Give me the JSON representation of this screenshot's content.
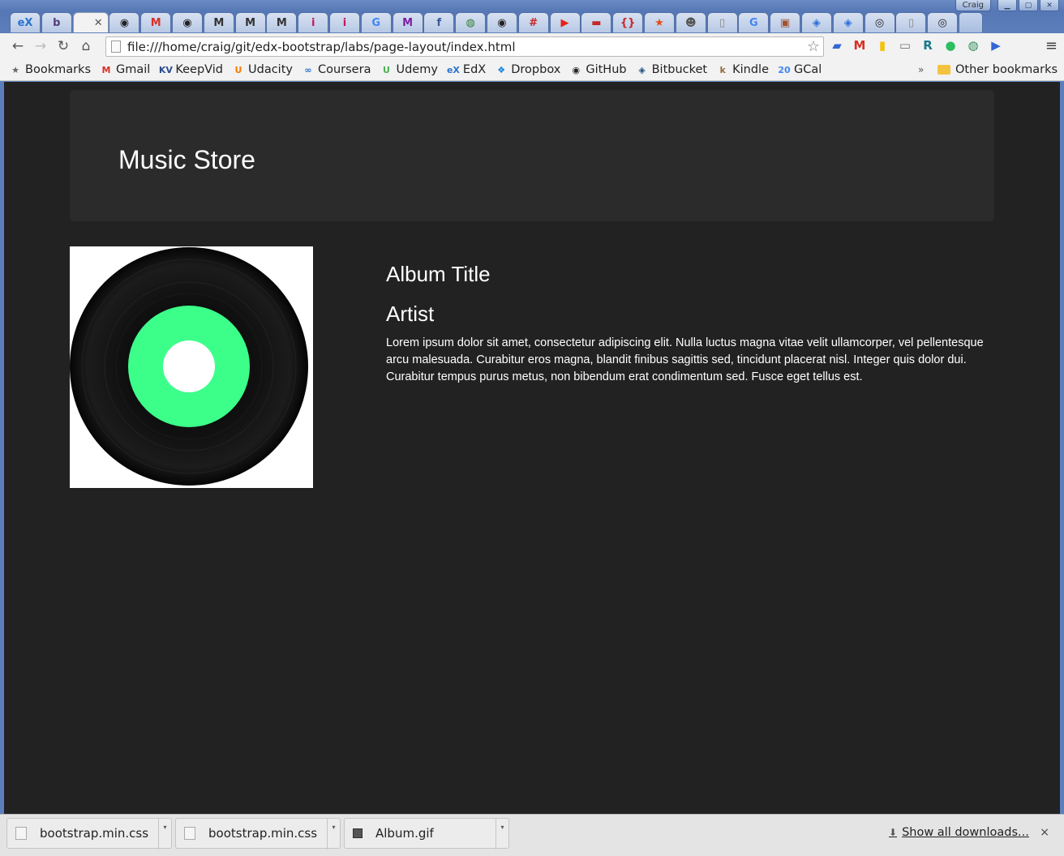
{
  "browser": {
    "profile_name": "Craig",
    "url": "file:///home/craig/git/edx-bootstrap/labs/page-layout/index.html",
    "tabs": [
      {
        "icon": "edx-icon",
        "glyph": "eX",
        "color": "#2a73cc"
      },
      {
        "icon": "bootstrap-icon",
        "glyph": "b",
        "color": "#563d7c"
      },
      {
        "icon": "close-icon",
        "glyph": "✕",
        "color": "#555"
      },
      {
        "icon": "github-icon",
        "glyph": "◉",
        "color": "#222"
      },
      {
        "icon": "gmail-icon",
        "glyph": "M",
        "color": "#d93025"
      },
      {
        "icon": "github-icon",
        "glyph": "◉",
        "color": "#222"
      },
      {
        "icon": "medium-icon",
        "glyph": "M",
        "color": "#333"
      },
      {
        "icon": "medium-icon",
        "glyph": "M",
        "color": "#333"
      },
      {
        "icon": "medium-icon",
        "glyph": "M",
        "color": "#333"
      },
      {
        "icon": "info-icon",
        "glyph": "i",
        "color": "#c2185b"
      },
      {
        "icon": "info-icon",
        "glyph": "i",
        "color": "#c2185b"
      },
      {
        "icon": "google-icon",
        "glyph": "G",
        "color": "#4285f4"
      },
      {
        "icon": "m-icon",
        "glyph": "M",
        "color": "#7b1fa2"
      },
      {
        "icon": "facebook-icon",
        "glyph": "f",
        "color": "#3b5998"
      },
      {
        "icon": "globe-icon",
        "glyph": "◍",
        "color": "#2e7d32"
      },
      {
        "icon": "github-icon",
        "glyph": "◉",
        "color": "#222"
      },
      {
        "icon": "slack-icon",
        "glyph": "#",
        "color": "#c62828"
      },
      {
        "icon": "youtube-icon",
        "glyph": "▶",
        "color": "#e62117"
      },
      {
        "icon": "red-tag-icon",
        "glyph": "▬",
        "color": "#c62828"
      },
      {
        "icon": "bracket-icon",
        "glyph": "{}",
        "color": "#c62828"
      },
      {
        "icon": "star-icon",
        "glyph": "★",
        "color": "#e64a19"
      },
      {
        "icon": "skull-icon",
        "glyph": "☻",
        "color": "#555"
      },
      {
        "icon": "page-icon",
        "glyph": "▯",
        "color": "#888"
      },
      {
        "icon": "google-icon",
        "glyph": "G",
        "color": "#4285f4"
      },
      {
        "icon": "image-icon",
        "glyph": "▣",
        "color": "#a0522d"
      },
      {
        "icon": "shield-icon",
        "glyph": "◈",
        "color": "#2a6fdb"
      },
      {
        "icon": "shield-icon",
        "glyph": "◈",
        "color": "#2a6fdb"
      },
      {
        "icon": "circle-icon",
        "glyph": "◎",
        "color": "#222"
      },
      {
        "icon": "page-icon",
        "glyph": "▯",
        "color": "#888"
      },
      {
        "icon": "circle-icon",
        "glyph": "◎",
        "color": "#222"
      }
    ],
    "extensions": [
      {
        "icon": "cast-tab-icon",
        "glyph": "▰",
        "color": "#3367d6"
      },
      {
        "icon": "gmail-icon",
        "glyph": "M",
        "color": "#d93025"
      },
      {
        "icon": "keep-icon",
        "glyph": "▮",
        "color": "#f4c20d"
      },
      {
        "icon": "cast-icon",
        "glyph": "▭",
        "color": "#777"
      },
      {
        "icon": "r-icon",
        "glyph": "R",
        "color": "#1a7a8a"
      },
      {
        "icon": "evernote-icon",
        "glyph": "●",
        "color": "#2dbe60"
      },
      {
        "icon": "globe-icon",
        "glyph": "◍",
        "color": "#2e8b57"
      },
      {
        "icon": "play-icon",
        "glyph": "▶",
        "color": "#3367d6"
      }
    ],
    "bookmarks": [
      {
        "label": "Bookmarks",
        "icon": "star-icon",
        "glyph": "★",
        "color": "#666"
      },
      {
        "label": "Gmail",
        "icon": "gmail-icon",
        "glyph": "M",
        "color": "#d93025"
      },
      {
        "label": "KeepVid",
        "icon": "keepvid-icon",
        "glyph": "KV",
        "color": "#2a4b8d"
      },
      {
        "label": "Udacity",
        "icon": "udacity-icon",
        "glyph": "U",
        "color": "#f57c00"
      },
      {
        "label": "Coursera",
        "icon": "coursera-icon",
        "glyph": "∞",
        "color": "#2a73cc"
      },
      {
        "label": "Udemy",
        "icon": "udemy-icon",
        "glyph": "U",
        "color": "#4caf50"
      },
      {
        "label": "EdX",
        "icon": "edx-icon",
        "glyph": "eX",
        "color": "#2a73cc"
      },
      {
        "label": "Dropbox",
        "icon": "dropbox-icon",
        "glyph": "❖",
        "color": "#007ee5"
      },
      {
        "label": "GitHub",
        "icon": "github-icon",
        "glyph": "◉",
        "color": "#222"
      },
      {
        "label": "Bitbucket",
        "icon": "bitbucket-icon",
        "glyph": "◈",
        "color": "#205081"
      },
      {
        "label": "Kindle",
        "icon": "kindle-icon",
        "glyph": "k",
        "color": "#8d6e3f"
      },
      {
        "label": "GCal",
        "icon": "gcal-icon",
        "glyph": "20",
        "color": "#4285f4"
      }
    ],
    "other_bookmarks": "Other bookmarks",
    "bookmarks_overflow": "»"
  },
  "page": {
    "jumbotron_title": "Music Store",
    "album_title": "Album Title",
    "artist": "Artist",
    "description": "Lorem ipsum dolor sit amet, consectetur adipiscing elit. Nulla luctus magna vitae velit ullamcorper, vel pellentesque arcu malesuada. Curabitur eros magna, blandit finibus sagittis sed, tincidunt placerat nisl. Integer quis dolor dui. Curabitur tempus purus metus, non bibendum erat condimentum sed. Fusce eget tellus est.",
    "colors": {
      "background": "#222222",
      "jumbotron": "#2b2b2b",
      "record_label": "#3cff8a"
    }
  },
  "downloads": {
    "items": [
      {
        "filename": "bootstrap.min.css",
        "type": "css"
      },
      {
        "filename": "bootstrap.min.css",
        "type": "css"
      },
      {
        "filename": "Album.gif",
        "type": "gif"
      }
    ],
    "show_all": "Show all downloads...",
    "close": "×"
  }
}
